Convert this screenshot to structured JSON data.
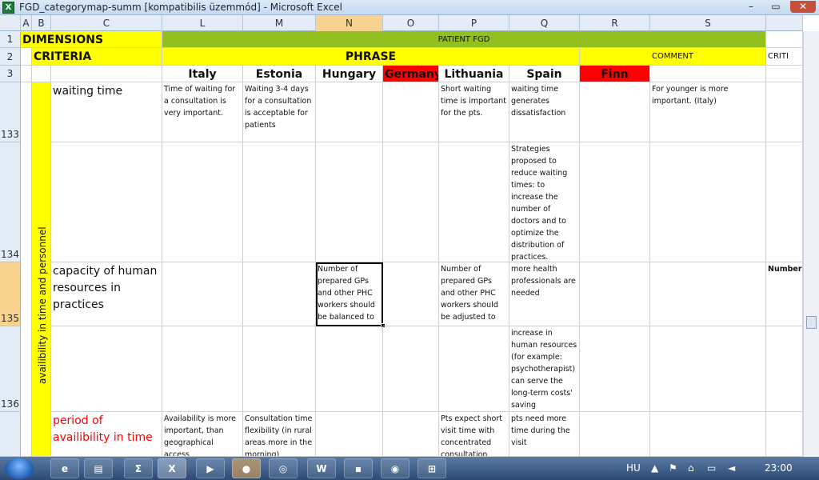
{
  "window": {
    "title": "FGD_categorymap-summ  [kompatibilis üzemmód] - Microsoft Excel",
    "app_icon": "X",
    "minimize": "–",
    "restore": "▭",
    "close": "✕"
  },
  "columns": [
    "A",
    "B",
    "C",
    "L",
    "M",
    "N",
    "O",
    "P",
    "Q",
    "R",
    "S"
  ],
  "rows": [
    "1",
    "2",
    "3",
    "133",
    "134",
    "135",
    "136",
    ""
  ],
  "header": {
    "dimensions": "DIMENSIONS",
    "criteria": "CRITERIA",
    "patient_fgd": "PATIENT FGD",
    "phrase": "PHRASE",
    "comment": "COMMENT",
    "crit_clip": "CRITI",
    "countries": [
      "Italy",
      "Estonia",
      "Hungary",
      "Germany",
      "Lithuania",
      "Spain",
      "Finn"
    ]
  },
  "dimension_label": "availibility in time and personnel",
  "criteria_rows": [
    {
      "criterion": "waiting time",
      "cells": {
        "L": "Time of waiting for a consultation is very important.",
        "M": "Waiting 3-4 days for a consultation is acceptable for patients",
        "N": "",
        "O": "",
        "P": "Short waiting time is important for the pts.",
        "Q": "waiting time generates dissatisfaction",
        "R": "",
        "S": "For younger is more important. (Italy)",
        "T": ""
      }
    },
    {
      "criterion": "",
      "cells": {
        "L": "",
        "M": "",
        "N": "",
        "O": "",
        "P": "",
        "Q": "Strategies proposed to reduce waiting times: to increase the number of doctors and to optimize the distribution of practices.",
        "R": "",
        "S": "",
        "T": ""
      }
    },
    {
      "criterion": "capacity of human resources in practices",
      "cells": {
        "L": "",
        "M": "",
        "N": "Number of prepared GPs and other PHC workers should be balanced to",
        "O": "",
        "P": "Number of prepared GPs and other PHC workers should be adjusted to",
        "Q": "more health professionals are needed",
        "R": "",
        "S": "",
        "T": "Number of and other number p practice"
      }
    },
    {
      "criterion": "",
      "cells": {
        "L": "",
        "M": "",
        "N": "",
        "O": "",
        "P": "",
        "Q": "increase in human resources (for example: psychotherapist) can serve the long-term costs' saving",
        "R": "",
        "S": "",
        "T": ""
      }
    },
    {
      "criterion": "period of availibility in time",
      "cells": {
        "L": "Availability is more important, than geographical access",
        "M": "Consultation time flexibility (in rural areas more in the morning)",
        "N": "",
        "O": "",
        "P": "Pts expect short visit time with concentrated consultation",
        "Q": "pts need more time during the visit",
        "R": "",
        "S": "",
        "T": ""
      }
    }
  ],
  "taskbar": {
    "icons": [
      "ie-icon",
      "explorer-icon",
      "sigma-icon",
      "excel-icon",
      "media-icon",
      "firefox-icon",
      "pdf-icon",
      "word-icon",
      "save-icon",
      "vodafone-icon",
      "network-icon"
    ],
    "language": "HU",
    "clock": "23:00"
  },
  "colors": {
    "header_yellow": "#ffff00",
    "patient_green": "#92c020",
    "country_red": "#ff0000",
    "criterion_red": "#ff0000",
    "selection_orange": "#f8d38f"
  }
}
